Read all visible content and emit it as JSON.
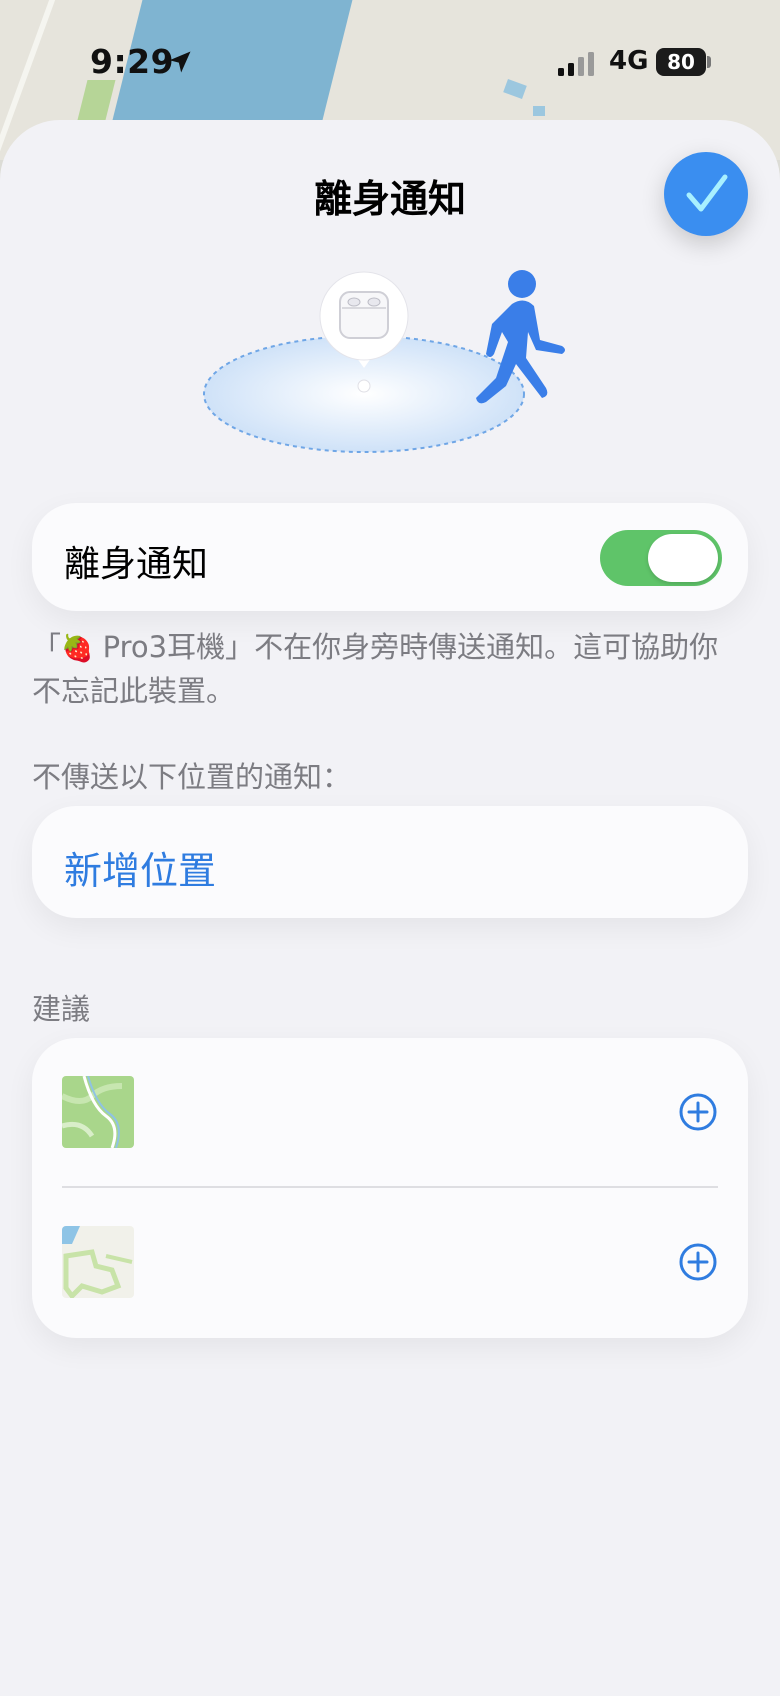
{
  "status_bar": {
    "time": "9:29",
    "network": "4G",
    "battery": "80"
  },
  "sheet": {
    "title": "離身通知"
  },
  "toggle": {
    "label": "離身通知",
    "on": true
  },
  "description": {
    "prefix": "「",
    "device_icon": "🍓",
    "text": " Pro3耳機」不在你身旁時傳送通知。這可協助你不忘記此裝置。"
  },
  "exclusions": {
    "header": "不傳送以下位置的通知：",
    "add_label": "新增位置"
  },
  "suggestions": {
    "header": "建議"
  },
  "colors": {
    "accent": "#2f7ce0",
    "done_button": "#3a8ef0",
    "toggle_on": "#5fc469",
    "secondary_text": "#7c7c82"
  },
  "icons": {
    "done": "checkmark-icon",
    "add_suggestion": "plus-circle-icon",
    "walking": "walking-person-icon",
    "device": "airpods-case-icon"
  }
}
